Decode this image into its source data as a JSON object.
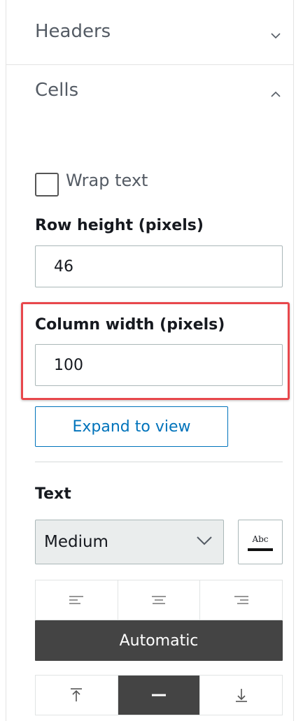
{
  "sections": {
    "headers": {
      "title": "Headers",
      "expanded": false,
      "chevron_icon": "chevron-down-icon"
    },
    "cells": {
      "title": "Cells",
      "expanded": true,
      "chevron_icon": "chevron-up-icon"
    }
  },
  "cells": {
    "wrap_text": {
      "label": "Wrap text",
      "checked": false
    },
    "row_height": {
      "label": "Row height (pixels)",
      "value": "46"
    },
    "column_width": {
      "label": "Column width (pixels)",
      "value": "100"
    },
    "expand_button": "Expand to view",
    "text": {
      "label": "Text",
      "font_size": {
        "value": "Medium"
      },
      "color_button": {
        "label": "Abc",
        "icon": "text-color-icon"
      },
      "horizontal_alignment": {
        "options": [
          {
            "icon": "align-left-icon",
            "active": false
          },
          {
            "icon": "align-center-icon",
            "active": false
          },
          {
            "icon": "align-right-icon",
            "active": false
          }
        ],
        "automatic_label": "Automatic"
      },
      "vertical_alignment": {
        "options": [
          {
            "icon": "align-top-icon",
            "active": false
          },
          {
            "icon": "align-middle-icon",
            "active": true
          },
          {
            "icon": "align-bottom-icon",
            "active": false
          }
        ]
      }
    }
  },
  "colors": {
    "highlight": "#e8474c",
    "accent": "#0073bb",
    "active_segment": "#444444"
  }
}
